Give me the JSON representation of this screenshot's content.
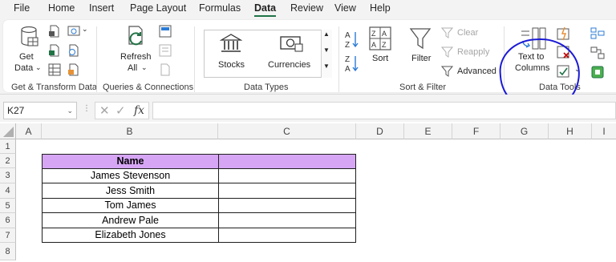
{
  "tabs": [
    "File",
    "Home",
    "Insert",
    "Page Layout",
    "Formulas",
    "Data",
    "Review",
    "View",
    "Help"
  ],
  "active_tab": "Data",
  "ribbon": {
    "get_transform": {
      "get_data_line1": "Get",
      "get_data_line2": "Data",
      "label": "Get & Transform Data"
    },
    "queries": {
      "refresh_line1": "Refresh",
      "refresh_line2": "All",
      "label": "Queries & Connections"
    },
    "data_types": {
      "stocks": "Stocks",
      "currencies": "Currencies",
      "label": "Data Types"
    },
    "sort_filter": {
      "sort": "Sort",
      "filter": "Filter",
      "clear": "Clear",
      "reapply": "Reapply",
      "advanced": "Advanced",
      "label": "Sort & Filter"
    },
    "data_tools": {
      "ttc_line1": "Text to",
      "ttc_line2": "Columns",
      "label": "Data Tools"
    }
  },
  "formula_bar": {
    "name_box": "K27",
    "fx": "fx",
    "value": ""
  },
  "columns": [
    "A",
    "B",
    "C",
    "D",
    "E",
    "F",
    "G",
    "H",
    "I"
  ],
  "rows": [
    "1",
    "2",
    "3",
    "4",
    "5",
    "6",
    "7",
    "8"
  ],
  "table": {
    "header": "Name",
    "names": [
      "James Stevenson",
      "Jess Smith",
      "Tom James",
      "Andrew Pale",
      "Elizabeth Jones"
    ]
  }
}
